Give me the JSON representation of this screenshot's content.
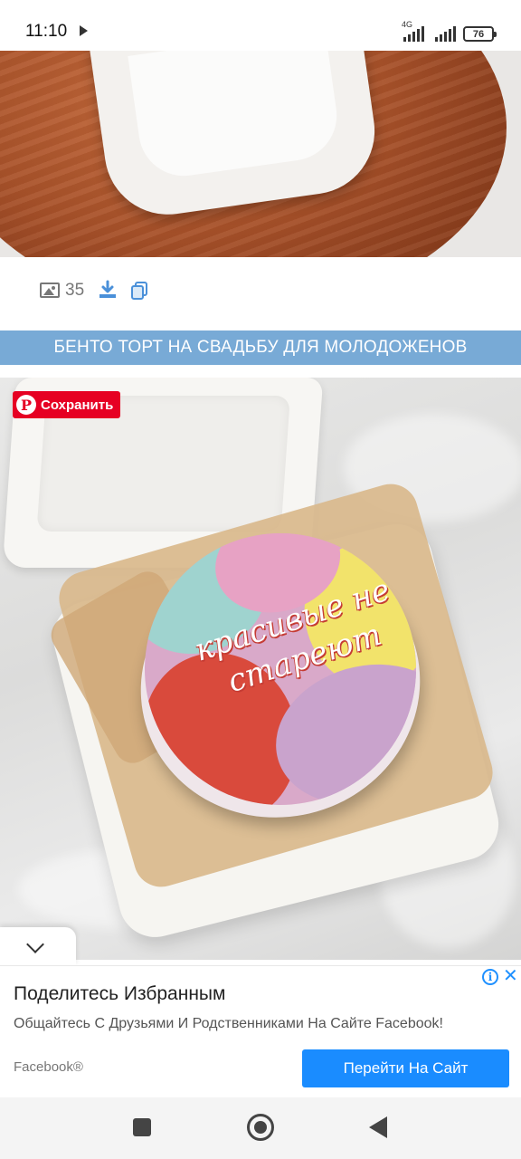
{
  "status_bar": {
    "time": "11:10",
    "network": "4G",
    "battery": "76"
  },
  "gallery": {
    "photo_count": "35"
  },
  "section": {
    "title": "БЕНТО ТОРТ НА СВАДЬБУ ДЛЯ МОЛОДОЖЕНОВ"
  },
  "photo": {
    "save_label": "Сохранить",
    "cake_inscription": "красивые не стареют",
    "pin_letter": "P"
  },
  "ad": {
    "title": "Поделитесь Избранным",
    "subtitle": "Общайтесь С Друзьями И Родственниками На Сайте Facebook!",
    "brand": "Facebook®",
    "cta": "Перейти На Сайт",
    "info_glyph": "i",
    "close_glyph": "✕"
  },
  "colors": {
    "section_bg": "#78aad6",
    "pinterest_red": "#e60023",
    "cta_blue": "#1a8cff"
  }
}
